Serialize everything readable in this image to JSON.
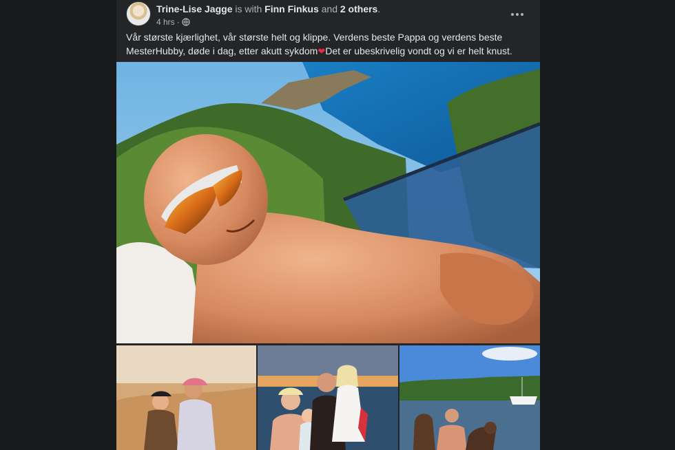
{
  "post": {
    "author": "Trine-Lise Jagge",
    "with_text": " is with ",
    "tagged": "Finn Finkus",
    "and_text": " and ",
    "others": "2 others",
    "period": ".",
    "time": "4 hrs",
    "separator": "·",
    "privacy_icon": "globe-icon",
    "more_icon": "more-horizontal-icon",
    "text_before_heart": "Vår største kjærlighet, vår største helt og klippe. Verdens beste Pappa og verdens beste MesterHubby, døde i dag, etter akutt sykdom",
    "heart": "❤",
    "text_after_heart": "Det er ubeskrivelig vondt og vi er helt knust."
  },
  "photos": [
    {
      "name": "man-sunbathing-photo"
    },
    {
      "name": "desert-couple-photo"
    },
    {
      "name": "family-sunset-photo"
    },
    {
      "name": "man-with-dogs-photo"
    }
  ],
  "colors": {
    "page_bg": "#18191a",
    "card_bg": "#242526",
    "primary_text": "#e4e6eb",
    "secondary_text": "#b0b3b8",
    "heart": "#f02849"
  }
}
